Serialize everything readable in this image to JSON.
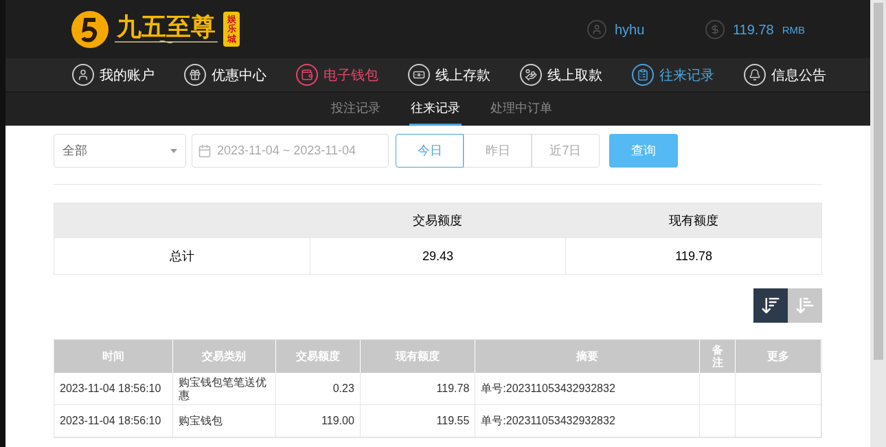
{
  "header": {
    "logo_text": "九五至尊",
    "logo_badge": "娱乐城",
    "username": "hyhu",
    "balance": "119.78",
    "currency": "RMB"
  },
  "nav": [
    {
      "label": "我的账户",
      "color": "#ffffff"
    },
    {
      "label": "优惠中心",
      "color": "#ffffff"
    },
    {
      "label": "电子钱包",
      "color": "#e8456b"
    },
    {
      "label": "线上存款",
      "color": "#ffffff"
    },
    {
      "label": "线上取款",
      "color": "#ffffff"
    },
    {
      "label": "往来记录",
      "color": "#4aa3df"
    },
    {
      "label": "信息公告",
      "color": "#ffffff"
    }
  ],
  "subtabs": [
    {
      "label": "投注记录",
      "selected": false
    },
    {
      "label": "往来记录",
      "selected": true
    },
    {
      "label": "处理中订单",
      "selected": false
    }
  ],
  "filters": {
    "type_select": "全部",
    "date_range": "2023-11-04 ~ 2023-11-04",
    "quick_dates": [
      {
        "label": "今日",
        "selected": true
      },
      {
        "label": "昨日",
        "selected": false
      },
      {
        "label": "近7日",
        "selected": false
      }
    ],
    "query_button": "查询"
  },
  "summary": {
    "columns": [
      "交易额度",
      "现有额度"
    ],
    "row": {
      "label": "总计",
      "values": [
        "29.43",
        "119.78"
      ]
    }
  },
  "sort_buttons": [
    {
      "selected": true
    },
    {
      "selected": false
    }
  ],
  "table": {
    "columns": [
      "时间",
      "交易类别",
      "交易额度",
      "现有额度",
      "摘要",
      "备注",
      "更多"
    ],
    "rows": [
      [
        "2023-11-04 18:56:10",
        "购宝钱包笔笔送优惠",
        "0.23",
        "119.78",
        "单号:202311053432932832",
        "",
        ""
      ],
      [
        "2023-11-04 18:56:10",
        "购宝钱包",
        "119.00",
        "119.55",
        "单号:202311053432932832",
        "",
        ""
      ]
    ]
  }
}
